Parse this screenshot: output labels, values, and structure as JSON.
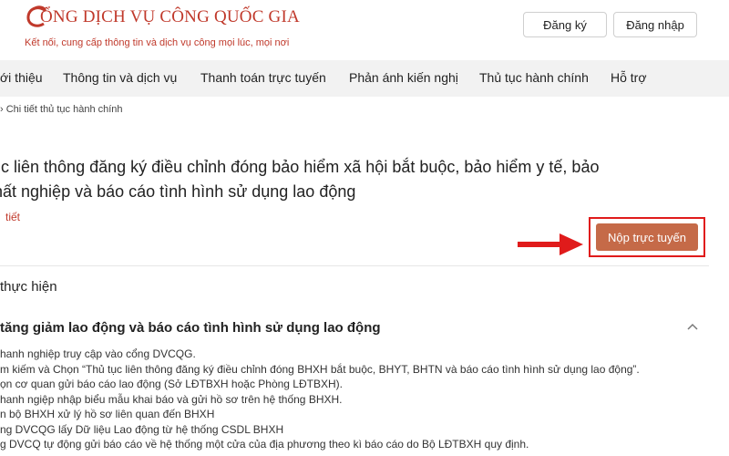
{
  "brand": {
    "title": "ỔNG DỊCH VỤ CÔNG QUỐC GIA",
    "subtitle": "Kết nối, cung cấp thông tin và dịch vụ công mọi lúc, mọi nơi"
  },
  "header": {
    "register_label": "Đăng ký",
    "login_label": "Đăng nhập"
  },
  "nav": {
    "items": [
      {
        "label": "ới thiệu"
      },
      {
        "label": "Thông tin và dịch vụ"
      },
      {
        "label": "Thanh toán trực tuyến"
      },
      {
        "label": "Phản ánh kiến nghị"
      },
      {
        "label": "Thủ tục hành chính"
      },
      {
        "label": "Hỗ trợ"
      }
    ]
  },
  "breadcrumb": "› Chi tiết thủ tục hành chính",
  "procedure": {
    "title_line1": "ục liên thông đăng ký điều chỉnh đóng bảo hiểm xã hội bắt buộc, bảo hiểm y tế, bảo",
    "title_line2": "hất nghiệp và báo cáo tình hình sử dụng lao động",
    "detail_link": "tiết",
    "submit_label": "Nộp trực tuyến"
  },
  "section": {
    "title": "thực hiện",
    "accordion_title": "tăng giảm lao động và báo cáo tình hình sử dụng lao động",
    "steps": [
      "hanh nghiệp truy cập vào cổng DVCQG.",
      "m kiếm và Chọn “Thủ tục liên thông đăng ký điều chỉnh đóng BHXH bắt buộc, BHYT, BHTN và báo cáo tình hình sử dụng lao động”.",
      "ọn cơ quan gửi báo cáo lao động (Sở LĐTBXH hoặc Phòng LĐTBXH).",
      "hanh ngiệp nhập biểu mẫu khai báo và gửi hồ sơ trên hệ thống BHXH.",
      "n bộ BHXH xử lý hồ sơ liên quan đến BHXH",
      "ng DVCQG lấy Dữ liệu Lao động từ hệ thống CSDL BHXH",
      "g DVCQ tự động gửi báo cáo về hệ thống một cửa của địa phương theo kì báo cáo do Bộ LĐTBXH quy định."
    ]
  },
  "colors": {
    "brand": "#c0392b",
    "submit_bg": "#c56a48",
    "highlight": "#e01b1b",
    "nav_bg": "#f2f2f2"
  },
  "icons": {
    "logo": "logo-emblem-icon",
    "arrow": "pointer-arrow-icon",
    "chevron": "chevron-up-icon"
  }
}
